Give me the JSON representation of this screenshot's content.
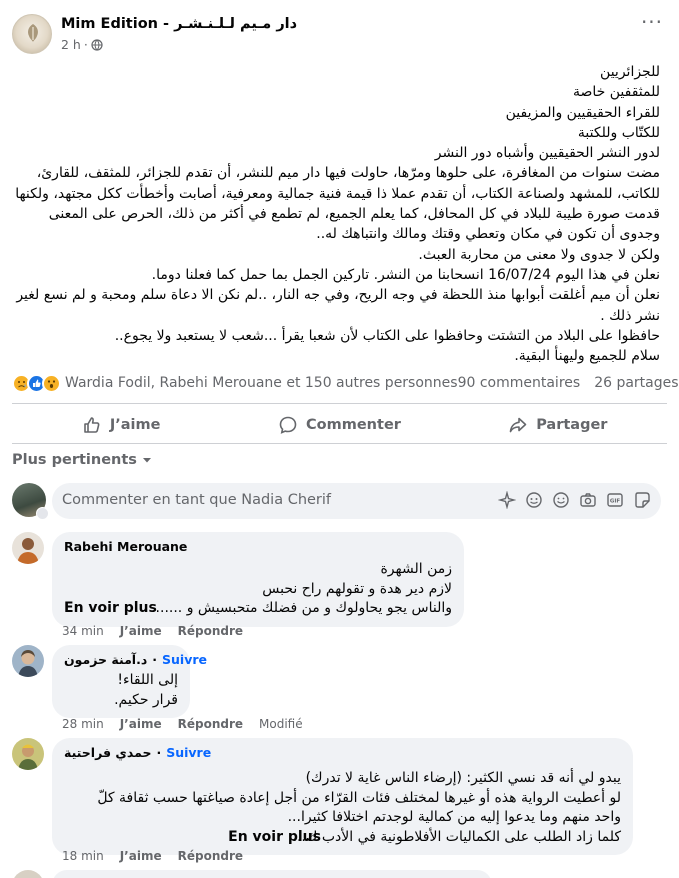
{
  "post": {
    "page_name": "Mim Edition - دار مـيم لـلـنـشـر",
    "time": "2 h",
    "visibility_icon": "globe-icon",
    "more_icon": "more-icon",
    "body": [
      "للجزائريين",
      "للمثقفين خاصة",
      "للقراء الحقيقيين والمزيفين",
      "للكتّاب وللكتبة",
      "لدور النشر الحقيقيين وأشباه دور النشر",
      "مضت سنوات من المغافرة، على حلوها ومرّها، حاولت فيها دار ميم للنشر، أن تقدم للجزائر، للمثقف، للقارئ، للكاتب، للمشهد ولصناعة الكتاب، أن تقدم عملا ذا قيمة فنية جمالية ومعرفية، أصابت وأخطأت ككل مجتهد، ولكنها قدمت صورة طيبة للبلاد في كل المحافل، كما يعلم الجميع، لم تطمع في أكثر من ذلك، الحرص على المعنى وجدوى أن تكون في مكان وتعطي وقتك ومالك وانتباهك له..",
      "ولكن لا جدوى ولا معنى من محاربة العبث.",
      "نعلن في هذا اليوم 16/07/24 انسحابنا من النشر. تاركين الجمل بما حمل كما فعلنا دوما.",
      " نعلن أن ميم أغلقت أبوابها منذ اللحظة في وجه الريح، وفي جه النار، ..لم نكن الا دعاة سلم ومحبة و لم نسع لغير نشر ذلك .",
      "حافظوا على البلاد من التشتت وحافظوا على الكتاب لأن شعبا يقرأ ...شعب لا يستعبد ولا يجوع..",
      "سلام للجميع وليهنأ البقية."
    ],
    "reactions": [
      "sad-reaction-icon",
      "like-reaction-icon",
      "wow-reaction-icon"
    ],
    "reactors_text": "Wardia Fodil, Rabehi Merouane et 150 autres personnes",
    "comments_count": "90 commentaires",
    "shares_count": "26 partages"
  },
  "actions": {
    "like": "J’aime",
    "comment": "Commenter",
    "share": "Partager"
  },
  "sort_label": "Plus pertinents",
  "composer": {
    "placeholder": "Commenter en tant que Nadia Cherif"
  },
  "comments": [
    {
      "author": "Rabehi Merouane",
      "follow": "",
      "lines": [
        "زمن الشهرة",
        "لازم دير هدة و تقولهم راح نحبس",
        "والناس يجو يحاولوك و من فضلك متحبسيش و ......."
      ],
      "see_more": "En voir plus",
      "time": "34 min",
      "like": "J’aime",
      "reply": "Répondre",
      "edited": ""
    },
    {
      "author": "د.آمنة حزمون",
      "follow": "Suivre",
      "lines": [
        "إلى اللقاء!",
        "قرار حكيم."
      ],
      "see_more": "",
      "time": "28 min",
      "like": "J’aime",
      "reply": "Répondre",
      "edited": "Modifié"
    },
    {
      "author": "حمدي فراحتية",
      "follow": "Suivre",
      "lines": [
        "يبدو لي أنه قد نسي الكثير: (إرضاء الناس غاية لا تدرك)",
        "لو أعطيت الرواية هذه أو غيرها لمختلف فئات القرّاء من أجل إعادة صياغتها حسب ثقافة كلّ",
        "واحد منهم وما يدعوا إليه من كمالية لوجدتم اختلافا كثيرا...",
        "كلما زاد الطلب على الكماليات الأفلاطونية في الأدب ك..."
      ],
      "see_more": "En voir plus",
      "time": "18 min",
      "like": "J’aime",
      "reply": "Répondre",
      "edited": ""
    }
  ]
}
